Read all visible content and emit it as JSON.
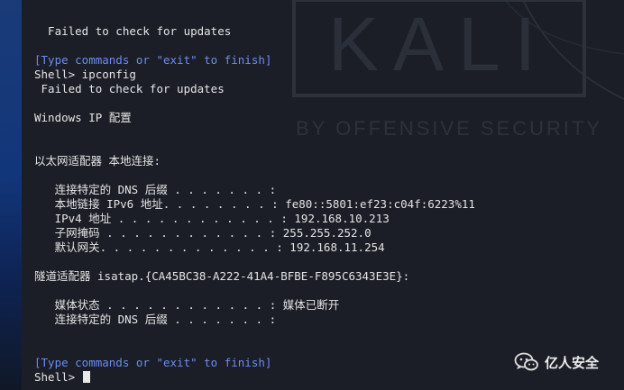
{
  "background": {
    "color": "#1b1e26",
    "left_strip_color": "#1a3b78"
  },
  "watermark": {
    "brand": "KALI",
    "tagline": "BY OFFENSIVE SECURITY"
  },
  "terminal": {
    "lines": [
      {
        "text": "  Failed to check for updates",
        "kind": "output"
      },
      {
        "text": "",
        "kind": "output"
      },
      {
        "text": "[Type commands or \"exit\" to finish]",
        "kind": "hint"
      },
      {
        "text": "Shell> ipconfig",
        "kind": "prompt"
      },
      {
        "text": " Failed to check for updates",
        "kind": "output"
      },
      {
        "text": "",
        "kind": "output"
      },
      {
        "text": "Windows IP 配置",
        "kind": "output"
      },
      {
        "text": "",
        "kind": "output"
      },
      {
        "text": "",
        "kind": "output"
      },
      {
        "text": "以太网适配器 本地连接:",
        "kind": "output"
      },
      {
        "text": "",
        "kind": "output"
      },
      {
        "text": "   连接特定的 DNS 后缀 . . . . . . . :",
        "kind": "output"
      },
      {
        "text": "   本地链接 IPv6 地址. . . . . . . . : fe80::5801:ef23:c04f:6223%11",
        "kind": "output"
      },
      {
        "text": "   IPv4 地址 . . . . . . . . . . . . : 192.168.10.213",
        "kind": "output"
      },
      {
        "text": "   子网掩码 . . . . . . . . . . . . : 255.255.252.0",
        "kind": "output"
      },
      {
        "text": "   默认网关. . . . . . . . . . . . . : 192.168.11.254",
        "kind": "output"
      },
      {
        "text": "",
        "kind": "output"
      },
      {
        "text": "隧道适配器 isatap.{CA45BC38-A222-41A4-BFBE-F895C6343E3E}:",
        "kind": "output"
      },
      {
        "text": "",
        "kind": "output"
      },
      {
        "text": "   媒体状态 . . . . . . . . . . . . : 媒体已断开",
        "kind": "output"
      },
      {
        "text": "   连接特定的 DNS 后缀 . . . . . . . :",
        "kind": "output"
      },
      {
        "text": "",
        "kind": "output"
      },
      {
        "text": "",
        "kind": "output"
      },
      {
        "text": "[Type commands or \"exit\" to finish]",
        "kind": "hint"
      },
      {
        "text": "Shell> ",
        "kind": "input"
      }
    ],
    "text_color": "#e4e4e4",
    "hint_color": "#6b8cf0"
  },
  "badge": {
    "label": "亿人安全",
    "icon": "wechat-icon"
  }
}
